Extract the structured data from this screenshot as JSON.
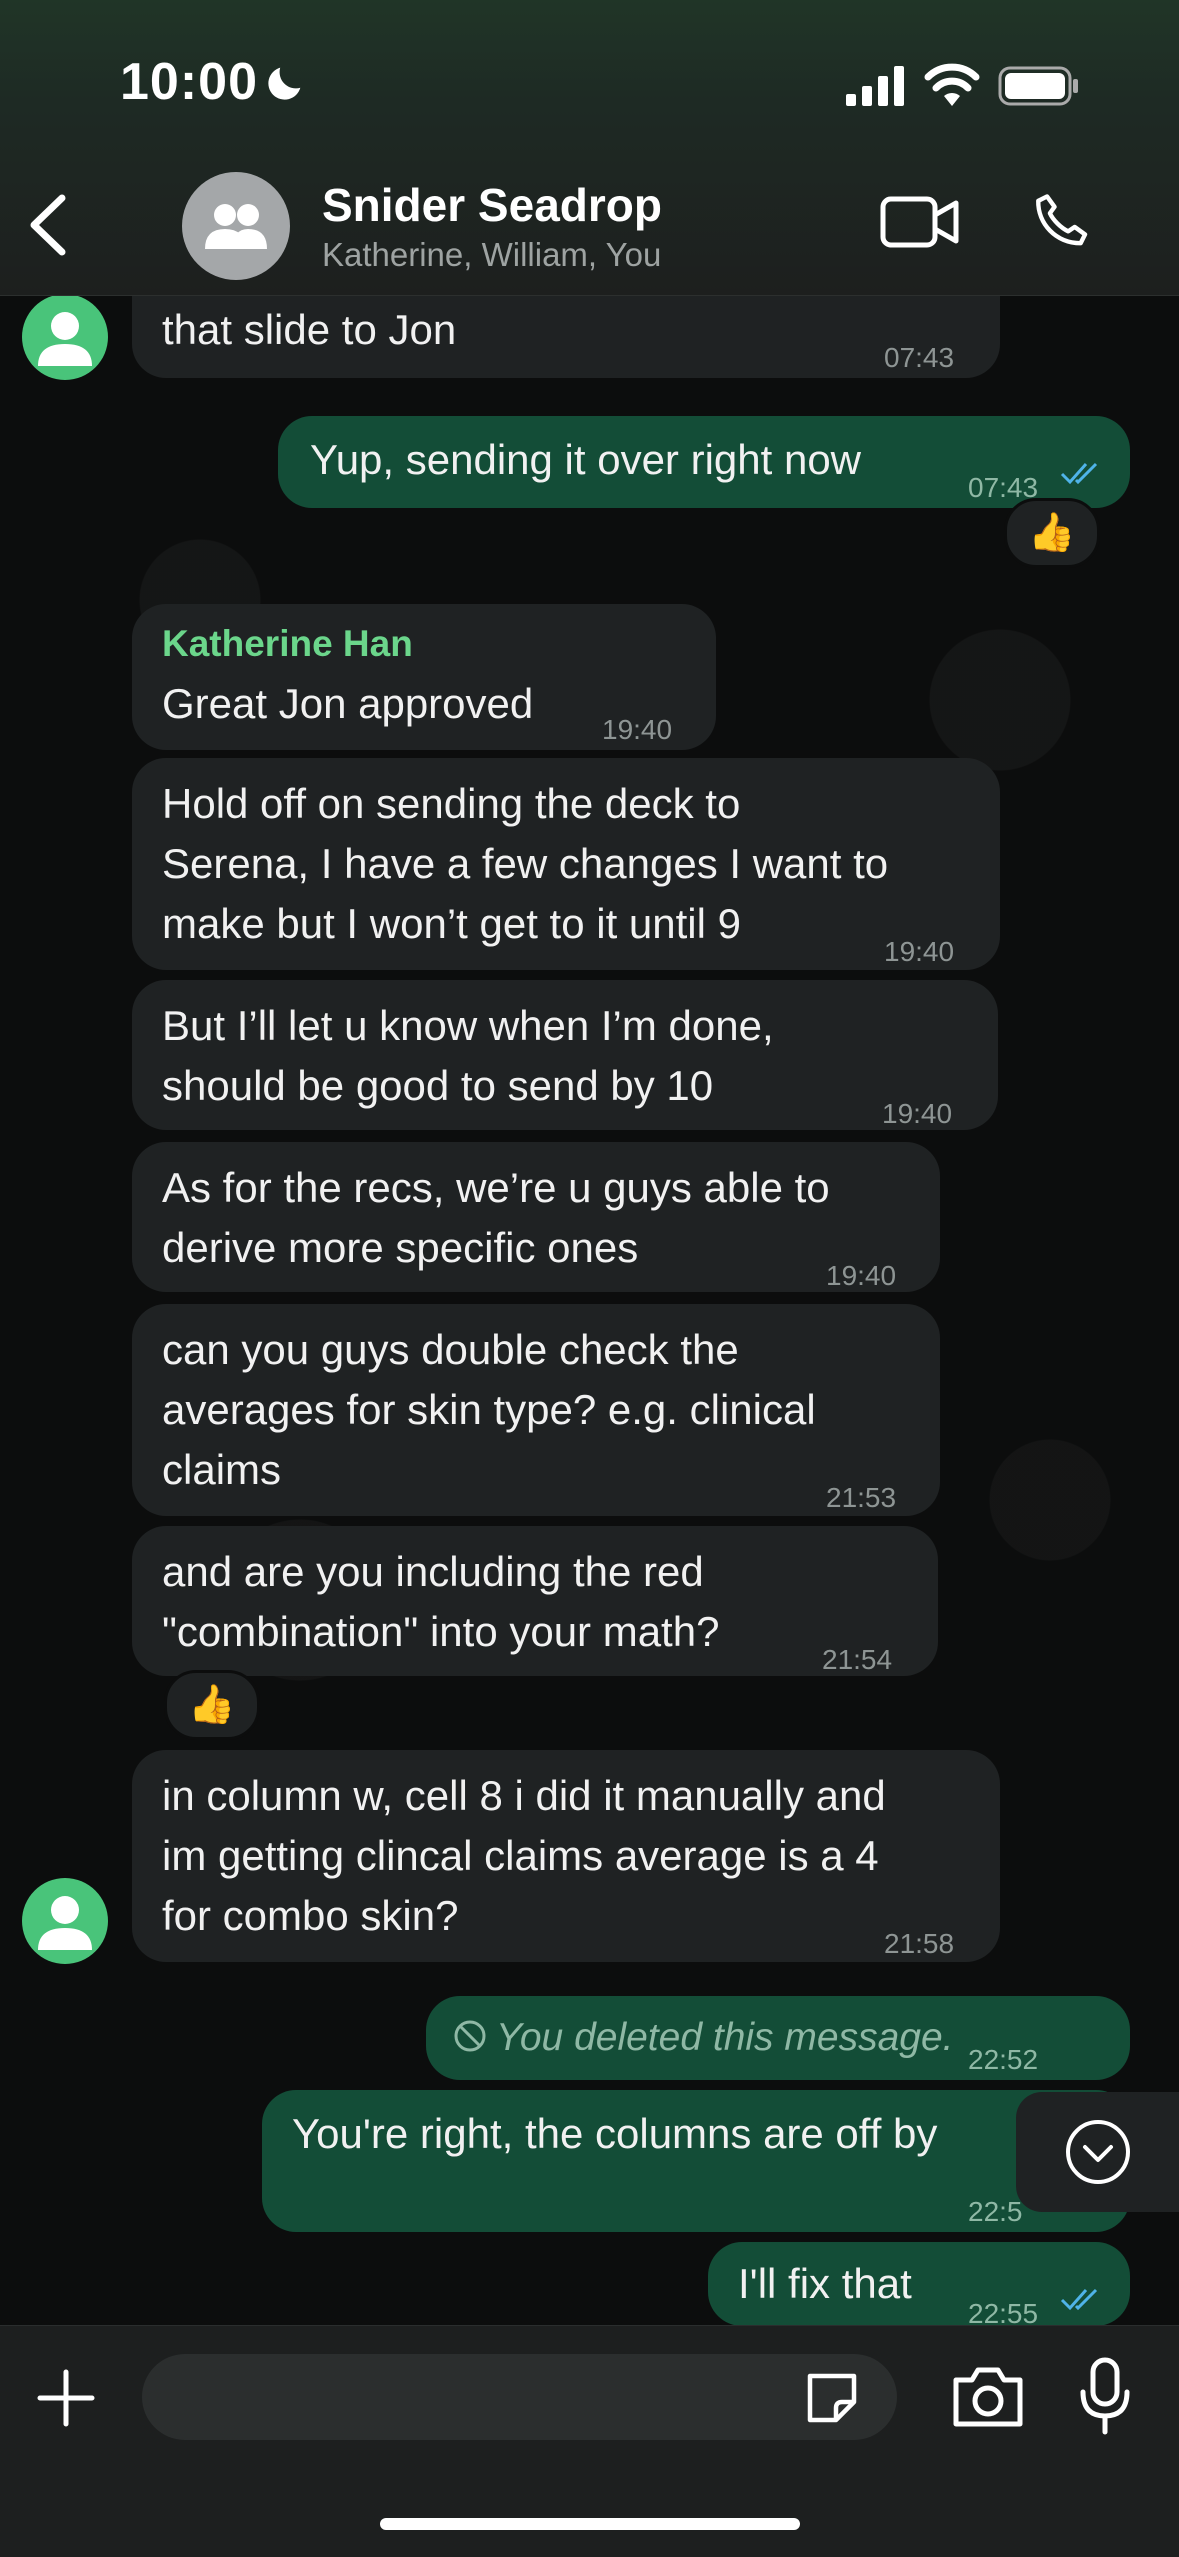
{
  "status_bar": {
    "time": "10:00"
  },
  "header": {
    "title": "Snider Seadrop",
    "subtitle": "Katherine, William, You"
  },
  "messages": [
    {
      "text": "that slide to Jon",
      "time": "07:43"
    },
    {
      "text": "Yup, sending it over right now",
      "time": "07:43",
      "reaction": "👍"
    },
    {
      "sender": "Katherine Han",
      "text": "Great Jon approved",
      "time": "19:40"
    },
    {
      "lines": [
        "Hold off on sending the deck to",
        "Serena, I have a few changes I want to",
        "make but I won’t get to it until 9"
      ],
      "time": "19:40"
    },
    {
      "lines": [
        "But I’ll let u know when I’m done,",
        "should be good to send by 10"
      ],
      "time": "19:40"
    },
    {
      "lines": [
        "As for the recs, we’re u guys able to",
        "derive more specific ones"
      ],
      "time": "19:40"
    },
    {
      "lines": [
        "can you guys double check the",
        "averages for skin type? e.g. clinical",
        "claims"
      ],
      "time": "21:53"
    },
    {
      "lines": [
        "and are you including the red",
        "\"combination\" into your math?"
      ],
      "time": "21:54",
      "reaction": "👍"
    },
    {
      "lines": [
        "in column w, cell 8 i did it manually and",
        "im getting clincal claims average is a 4",
        "for combo skin?"
      ],
      "time": "21:58"
    },
    {
      "text": "You deleted this message.",
      "time": "22:52"
    },
    {
      "text": "You're right, the columns are off by",
      "time": "22:5"
    },
    {
      "text": "I'll fix that",
      "time": "22:55"
    }
  ],
  "composer": {
    "placeholder": ""
  },
  "colors": {
    "outgoing": "#134d37",
    "incoming": "#1f2223",
    "sender_name": "#6bd68b",
    "read_check": "#4fb3e8"
  }
}
